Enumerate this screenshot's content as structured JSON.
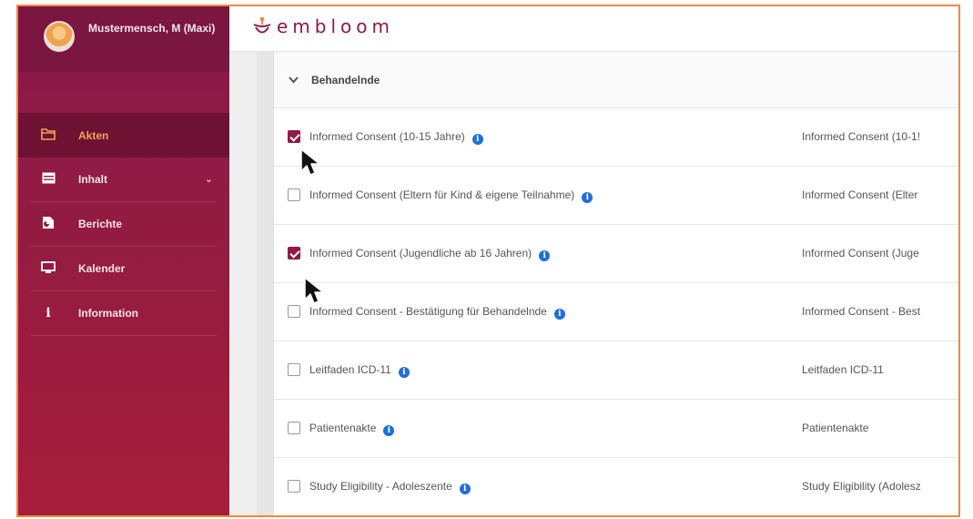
{
  "user": {
    "name": "Mustermensch, M (Maxi)"
  },
  "sidebar": {
    "items": [
      {
        "icon": "folder-icon",
        "label": "Akten",
        "active": true
      },
      {
        "icon": "table-icon",
        "label": "Inhalt",
        "has_dropdown": true
      },
      {
        "icon": "report-icon",
        "label": "Berichte"
      },
      {
        "icon": "monitor-icon",
        "label": "Kalender"
      },
      {
        "icon": "info-letter-icon",
        "label": "Information"
      }
    ]
  },
  "brand": {
    "name": "embloom",
    "color": "#8e1a48"
  },
  "accent": {
    "active_nav": "#f0a650",
    "info": "#1f6fd6",
    "frame": "#f08a3c"
  },
  "section": {
    "title": "Behandelnde"
  },
  "rows": [
    {
      "label": "Informed Consent (10-15 Jahre)",
      "right": "Informed Consent (10-1!",
      "checked": true
    },
    {
      "label": "Informed Consent (Eltern für Kind & eigene Teilnahme)",
      "right": "Informed Consent (Elter",
      "checked": false
    },
    {
      "label": "Informed Consent (Jugendliche ab 16 Jahren)",
      "right": "Informed Consent (Juge",
      "checked": true
    },
    {
      "label": "Informed Consent - Bestätigung für Behandelnde",
      "right": "Informed Consent - Best",
      "checked": false
    },
    {
      "label": "Leitfaden ICD-11",
      "right": "Leitfaden ICD-11",
      "checked": false
    },
    {
      "label": "Patientenakte",
      "right": "Patientenakte",
      "checked": false
    },
    {
      "label": "Study Eligibility - Adoleszente",
      "right": "Study Eligibility (Adolesz",
      "checked": false
    }
  ]
}
